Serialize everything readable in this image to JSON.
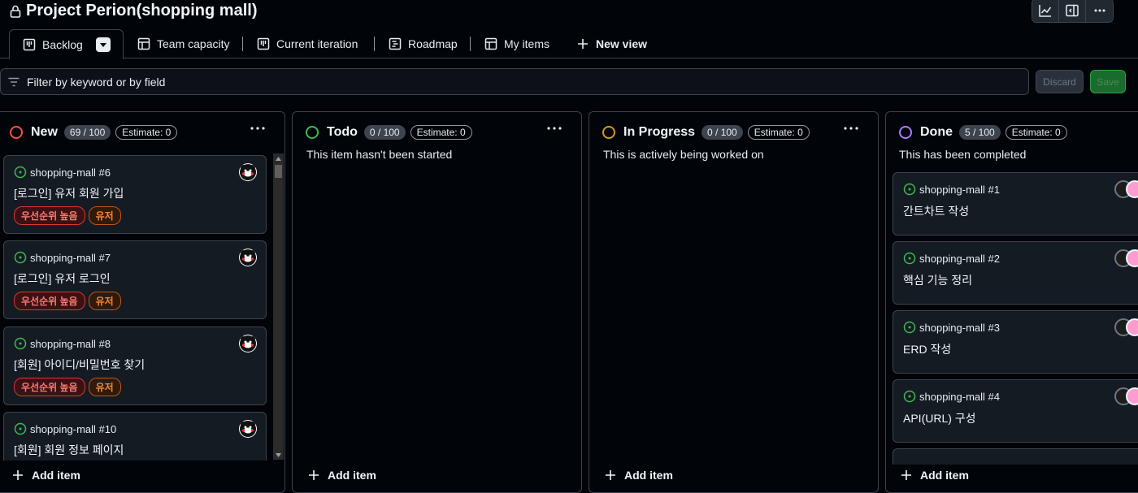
{
  "project": {
    "title": "Project Perion(shopping mall)"
  },
  "tabs": [
    {
      "label": "Backlog"
    },
    {
      "label": "Team capacity"
    },
    {
      "label": "Current iteration"
    },
    {
      "label": "Roadmap"
    },
    {
      "label": "My items"
    },
    {
      "label": "New view"
    }
  ],
  "filter": {
    "placeholder": "Filter by keyword or by field"
  },
  "actions": {
    "discard": "Discard",
    "save": "Save"
  },
  "colors": {
    "new": "#f85149",
    "todo": "#3fb950",
    "in_progress": "#d29922",
    "done": "#ab7df8",
    "issue_open": "#3fb950"
  },
  "columns": {
    "new": {
      "name": "New",
      "count": "69 / 100",
      "estimate": "Estimate: 0",
      "add": "Add item",
      "cards": [
        {
          "ref": "shopping-mall #6",
          "title": "[로그인] 유저 회원 가입",
          "labels": [
            "우선순위 높음",
            "유저"
          ]
        },
        {
          "ref": "shopping-mall #7",
          "title": "[로그인] 유저 로그인",
          "labels": [
            "우선순위 높음",
            "유저"
          ]
        },
        {
          "ref": "shopping-mall #8",
          "title": "[회원] 아이디/비밀번호 찾기",
          "labels": [
            "우선순위 높음",
            "유저"
          ]
        },
        {
          "ref": "shopping-mall #10",
          "title": "[회원] 회원 정보 페이지"
        }
      ]
    },
    "todo": {
      "name": "Todo",
      "count": "0 / 100",
      "estimate": "Estimate: 0",
      "desc": "This item hasn't been started",
      "add": "Add item"
    },
    "in_progress": {
      "name": "In Progress",
      "count": "0 / 100",
      "estimate": "Estimate: 0",
      "desc": "This is actively being worked on",
      "add": "Add item"
    },
    "done": {
      "name": "Done",
      "count": "5 / 100",
      "estimate": "Estimate: 0",
      "desc": "This has been completed",
      "add": "Add item",
      "cards": [
        {
          "ref": "shopping-mall #1",
          "title": "간트차트 작성"
        },
        {
          "ref": "shopping-mall #2",
          "title": "핵심 기능 정리"
        },
        {
          "ref": "shopping-mall #3",
          "title": "ERD 작성"
        },
        {
          "ref": "shopping-mall #4",
          "title": "API(URL) 구성"
        }
      ]
    }
  }
}
